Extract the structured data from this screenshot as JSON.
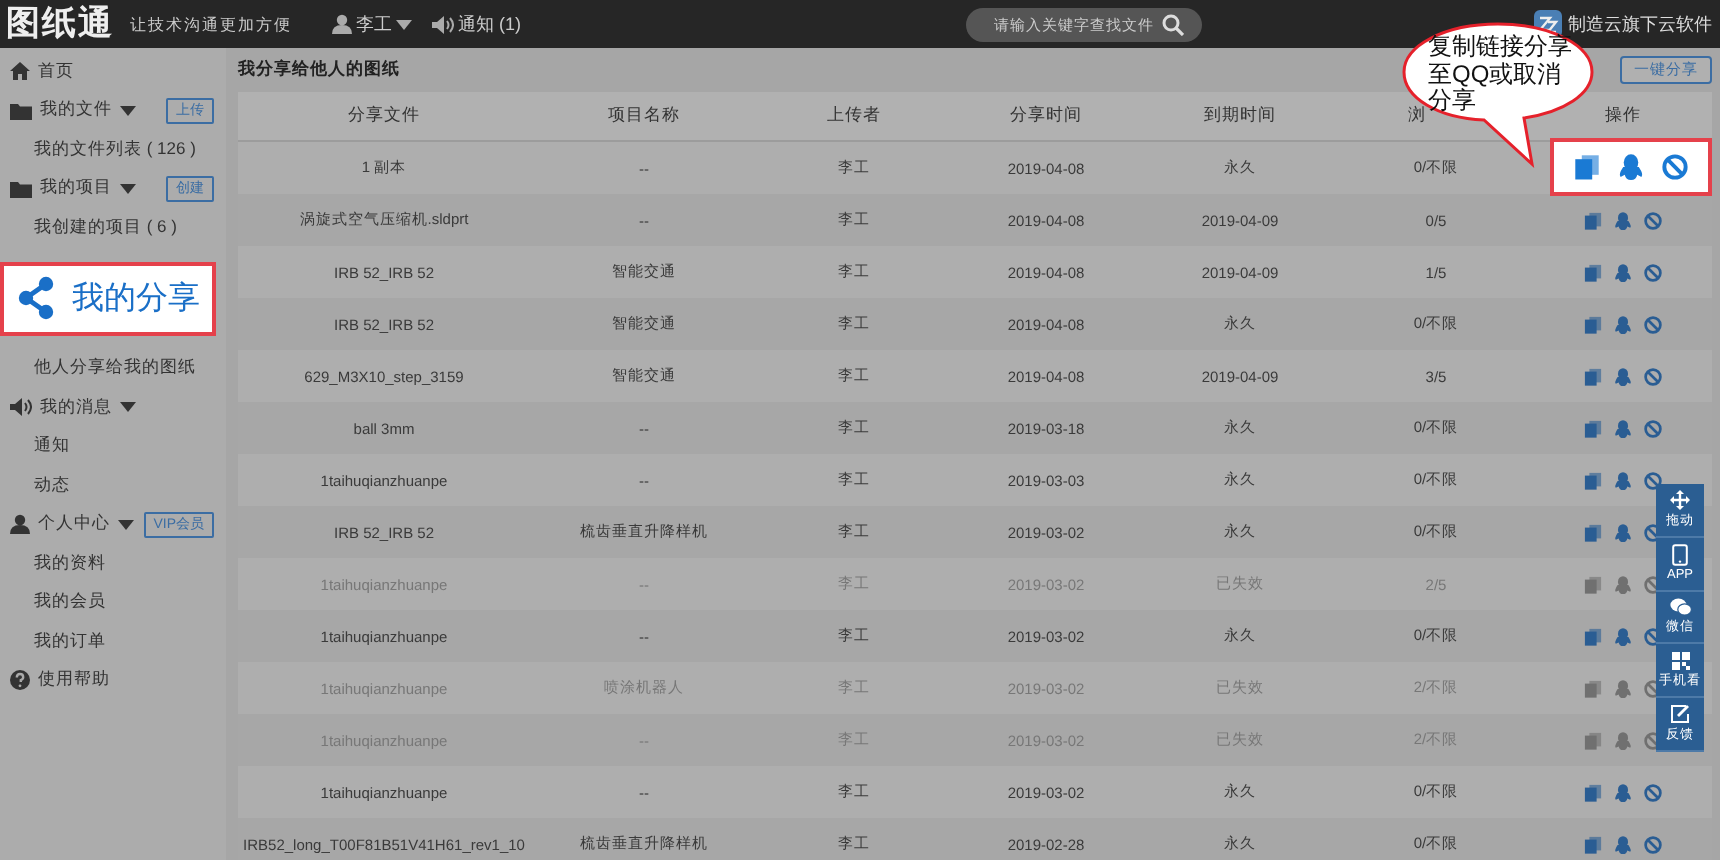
{
  "topbar": {
    "logo": "图纸通",
    "slogan": "让技术沟通更加方便",
    "user": "李工",
    "notice": "通知 (1)",
    "search": {
      "placeholder": "请输入关键字查找文件"
    },
    "brand": "制造云旗下云软件"
  },
  "sidebar": {
    "items": [
      {
        "kind": "link",
        "label": "首页"
      },
      {
        "kind": "group",
        "label": "我的文件",
        "button": "上传"
      },
      {
        "kind": "sub",
        "label": "我的文件列表 ( 126 )"
      },
      {
        "kind": "group",
        "label": "我的项目",
        "button": "创建"
      },
      {
        "kind": "sub",
        "label": "我创建的项目 ( 6 )"
      },
      {
        "kind": "highlight",
        "label": "我的分享"
      },
      {
        "kind": "sub",
        "label": "他人分享给我的图纸"
      },
      {
        "kind": "group",
        "label": "我的消息"
      },
      {
        "kind": "sub",
        "label": "通知"
      },
      {
        "kind": "sub",
        "label": "动态"
      },
      {
        "kind": "group",
        "label": "个人中心",
        "button": "VIP会员"
      },
      {
        "kind": "sub",
        "label": "我的资料"
      },
      {
        "kind": "sub",
        "label": "我的会员"
      },
      {
        "kind": "sub",
        "label": "我的订单"
      },
      {
        "kind": "link",
        "label": "使用帮助"
      }
    ]
  },
  "table": {
    "title": "我分享给他人的图纸",
    "button": "一键分享",
    "columns": [
      "分享文件",
      "项目名称",
      "上传者",
      "分享时间",
      "到期时间",
      "浏",
      "操作"
    ],
    "rows": [
      {
        "file": "1 副本",
        "project": "--",
        "uploader": "李工",
        "shared": "2019-04-08",
        "expires": "永久",
        "views": "0/不限",
        "expired": false,
        "highlighted": true
      },
      {
        "file": "涡旋式空气压缩机.sldprt",
        "project": "--",
        "uploader": "李工",
        "shared": "2019-04-08",
        "expires": "2019-04-09",
        "views": "0/5",
        "expired": false,
        "highlighted": false
      },
      {
        "file": "IRB 52_IRB 52",
        "project": "智能交通",
        "uploader": "李工",
        "shared": "2019-04-08",
        "expires": "2019-04-09",
        "views": "1/5",
        "expired": false,
        "highlighted": false
      },
      {
        "file": "IRB 52_IRB 52",
        "project": "智能交通",
        "uploader": "李工",
        "shared": "2019-04-08",
        "expires": "永久",
        "views": "0/不限",
        "expired": false,
        "highlighted": false
      },
      {
        "file": "629_M3X10_step_3159",
        "project": "智能交通",
        "uploader": "李工",
        "shared": "2019-04-08",
        "expires": "2019-04-09",
        "views": "3/5",
        "expired": false,
        "highlighted": false
      },
      {
        "file": "ball 3mm",
        "project": "--",
        "uploader": "李工",
        "shared": "2019-03-18",
        "expires": "永久",
        "views": "0/不限",
        "expired": false,
        "highlighted": false
      },
      {
        "file": "1taihuqianzhuanpe",
        "project": "--",
        "uploader": "李工",
        "shared": "2019-03-03",
        "expires": "永久",
        "views": "0/不限",
        "expired": false,
        "highlighted": false
      },
      {
        "file": "IRB 52_IRB 52",
        "project": "梳齿垂直升降样机",
        "uploader": "李工",
        "shared": "2019-03-02",
        "expires": "永久",
        "views": "0/不限",
        "expired": false,
        "highlighted": false
      },
      {
        "file": "1taihuqianzhuanpe",
        "project": "--",
        "uploader": "李工",
        "shared": "2019-03-02",
        "expires": "已失效",
        "views": "2/5",
        "expired": true,
        "highlighted": false
      },
      {
        "file": "1taihuqianzhuanpe",
        "project": "--",
        "uploader": "李工",
        "shared": "2019-03-02",
        "expires": "永久",
        "views": "0/不限",
        "expired": false,
        "highlighted": false
      },
      {
        "file": "1taihuqianzhuanpe",
        "project": "喷涂机器人",
        "uploader": "李工",
        "shared": "2019-03-02",
        "expires": "已失效",
        "views": "2/不限",
        "expired": true,
        "highlighted": false
      },
      {
        "file": "1taihuqianzhuanpe",
        "project": "--",
        "uploader": "李工",
        "shared": "2019-03-02",
        "expires": "已失效",
        "views": "2/不限",
        "expired": true,
        "highlighted": false
      },
      {
        "file": "1taihuqianzhuanpe",
        "project": "--",
        "uploader": "李工",
        "shared": "2019-03-02",
        "expires": "永久",
        "views": "0/不限",
        "expired": false,
        "highlighted": false
      },
      {
        "file": "IRB52_long_T00F81B51V41H61_rev1_10",
        "project": "梳齿垂直升降样机",
        "uploader": "李工",
        "shared": "2019-02-28",
        "expires": "永久",
        "views": "0/不限",
        "expired": false,
        "highlighted": false
      }
    ]
  },
  "callout": {
    "text": "复制链接分享至QQ或取消分享"
  },
  "float_toolbar": {
    "items": [
      "拖动",
      "APP",
      "微信",
      "手机看",
      "反馈"
    ]
  }
}
